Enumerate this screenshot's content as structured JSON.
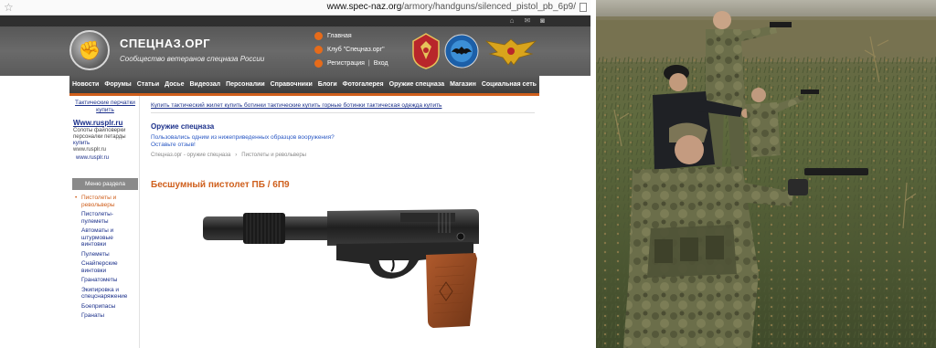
{
  "browser": {
    "url_host": "www.spec-naz.org",
    "url_path": "/armory/handguns/silenced_pistol_pb_6p9/"
  },
  "header": {
    "site_title": "СПЕЦНАЗ.ОРГ",
    "site_subtitle": "Сообщество ветеранов спецназа России",
    "links": {
      "home": "Главная",
      "club": "Клуб \"Спецназ.орг\"",
      "register": "Регистрация",
      "login": "Вход",
      "separator": "|"
    }
  },
  "nav": [
    "Новости",
    "Форумы",
    "Статьи",
    "Досье",
    "Видеозал",
    "Персоналии",
    "Справочники",
    "Блоги",
    "Фотогалерея",
    "Оружие спецназа",
    "Магазин",
    "Социальная сеть"
  ],
  "sidebar": {
    "ad_top": "Тактические перчатки купить",
    "ad_title": "Www.rusplr.ru",
    "ad_text": "Солоты файловерки персоналки петарды",
    "ad_link": "купить",
    "ad_domain": "www.rusplr.ru",
    "ad_url": "www.rusplr.ru",
    "menu_header": "Меню раздела",
    "menu": [
      {
        "label": "Пистолеты и револьверы",
        "active": true
      },
      {
        "label": "Пистолеты-пулеметы",
        "active": false
      },
      {
        "label": "Автоматы и штурмовые винтовки",
        "active": false
      },
      {
        "label": "Пулеметы",
        "active": false
      },
      {
        "label": "Снайперские винтовки",
        "active": false
      },
      {
        "label": "Гранатометы",
        "active": false
      },
      {
        "label": "Экипировка и спецснаряжение",
        "active": false
      },
      {
        "label": "Боеприпасы",
        "active": false
      },
      {
        "label": "Гранаты",
        "active": false
      }
    ]
  },
  "content": {
    "ads_line": "Купить тактический жилет купить ботинки тактические купить горные ботинки тактическая одежда купить",
    "section_title": "Оружие спецназа",
    "question": "Пользовались одним из нижеприведенных образцов вооружения?",
    "question_link": "Оставьте отзыв!",
    "breadcrumb": [
      "Спецназ.орг - оружие спецназа",
      "Пистолеты и револьверы"
    ],
    "breadcrumb_sep": "›",
    "page_title": "Бесшумный пистолет ПБ / 6П9"
  },
  "icons": {
    "star": "star-icon",
    "page": "page-icon",
    "home": "home-icon",
    "mail": "mail-icon",
    "rss": "rss-icon"
  },
  "colors": {
    "accent": "#cf5f1c",
    "link": "#1a2f8a",
    "header_bg": "#5f5f5f"
  }
}
